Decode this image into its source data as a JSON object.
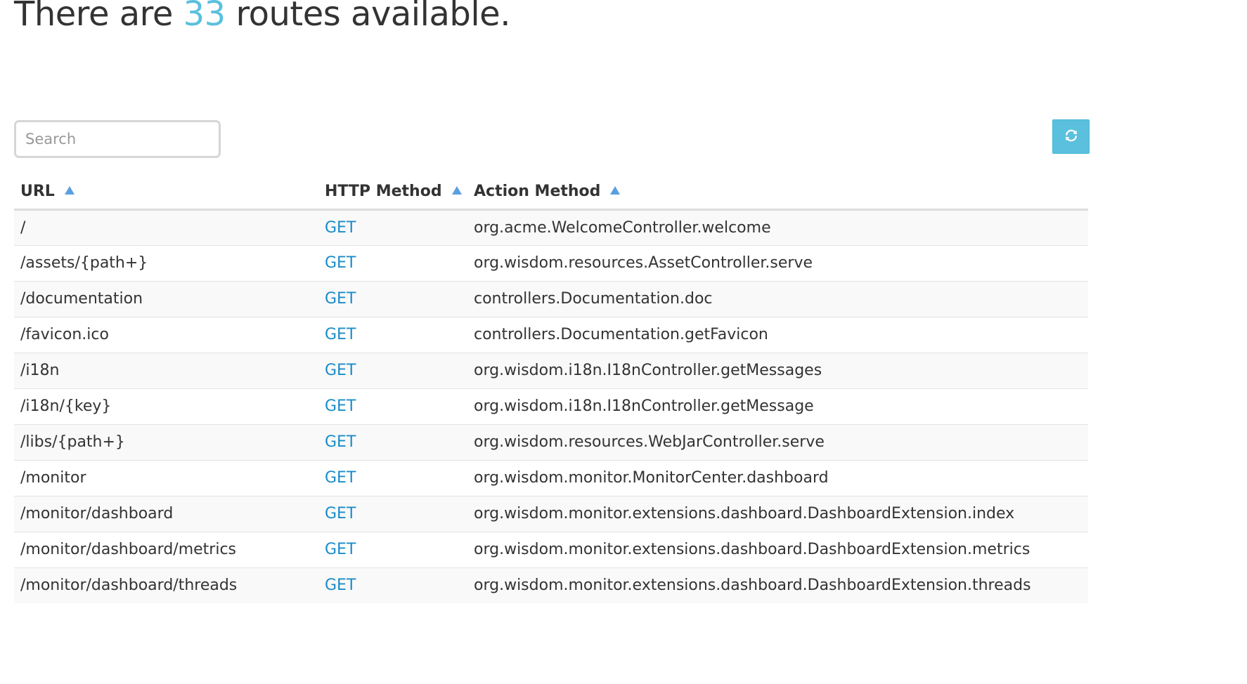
{
  "header": {
    "prefix": "There are ",
    "count": "33",
    "suffix": " routes available."
  },
  "search": {
    "placeholder": "Search",
    "value": ""
  },
  "toolbar": {
    "refresh_icon": "refresh-icon",
    "accent_color": "#5bc0de"
  },
  "table": {
    "columns": [
      {
        "label": "URL",
        "sort": "ascending"
      },
      {
        "label": "HTTP Method",
        "sort": "ascending"
      },
      {
        "label": "Action Method",
        "sort": "ascending"
      }
    ],
    "rows": [
      {
        "url": "/",
        "method": "GET",
        "action": "org.acme.WelcomeController.welcome"
      },
      {
        "url": "/assets/{path+}",
        "method": "GET",
        "action": "org.wisdom.resources.AssetController.serve"
      },
      {
        "url": "/documentation",
        "method": "GET",
        "action": "controllers.Documentation.doc"
      },
      {
        "url": "/favicon.ico",
        "method": "GET",
        "action": "controllers.Documentation.getFavicon"
      },
      {
        "url": "/i18n",
        "method": "GET",
        "action": "org.wisdom.i18n.I18nController.getMessages"
      },
      {
        "url": "/i18n/{key}",
        "method": "GET",
        "action": "org.wisdom.i18n.I18nController.getMessage"
      },
      {
        "url": "/libs/{path+}",
        "method": "GET",
        "action": "org.wisdom.resources.WebJarController.serve"
      },
      {
        "url": "/monitor",
        "method": "GET",
        "action": "org.wisdom.monitor.MonitorCenter.dashboard"
      },
      {
        "url": "/monitor/dashboard",
        "method": "GET",
        "action": "org.wisdom.monitor.extensions.dashboard.DashboardExtension.index"
      },
      {
        "url": "/monitor/dashboard/metrics",
        "method": "GET",
        "action": "org.wisdom.monitor.extensions.dashboard.DashboardExtension.metrics"
      },
      {
        "url": "/monitor/dashboard/threads",
        "method": "GET",
        "action": "org.wisdom.monitor.extensions.dashboard.DashboardExtension.threads"
      }
    ]
  }
}
